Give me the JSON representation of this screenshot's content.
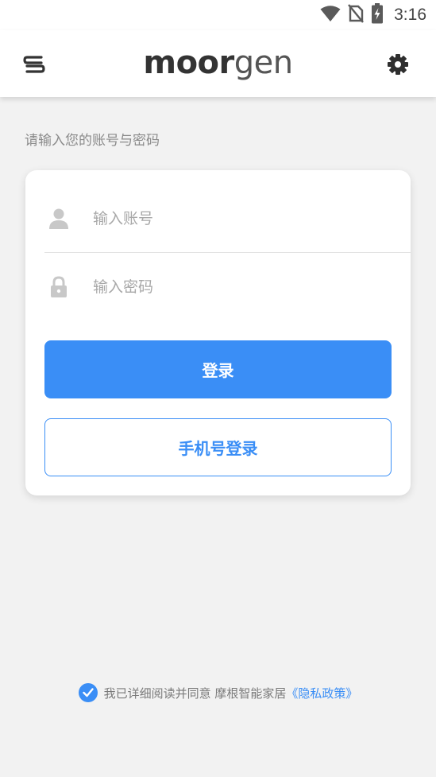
{
  "status_bar": {
    "time": "3:16",
    "icons": [
      "wifi-icon",
      "no-sim-icon",
      "battery-charging-icon"
    ]
  },
  "app_bar": {
    "logo_bold": "moor",
    "logo_light": "gen",
    "menu_icon": "menu-icon",
    "settings_icon": "gear-icon"
  },
  "login": {
    "instruction": "请输入您的账号与密码",
    "account_placeholder": "输入账号",
    "password_placeholder": "输入密码",
    "login_button": "登录",
    "phone_login_button": "手机号登录"
  },
  "agreement": {
    "checked": true,
    "text": "我已详细阅读并同意 摩根智能家居",
    "link": "《隐私政策》"
  },
  "colors": {
    "accent": "#3a8ef6",
    "background": "#f2f2f2"
  }
}
